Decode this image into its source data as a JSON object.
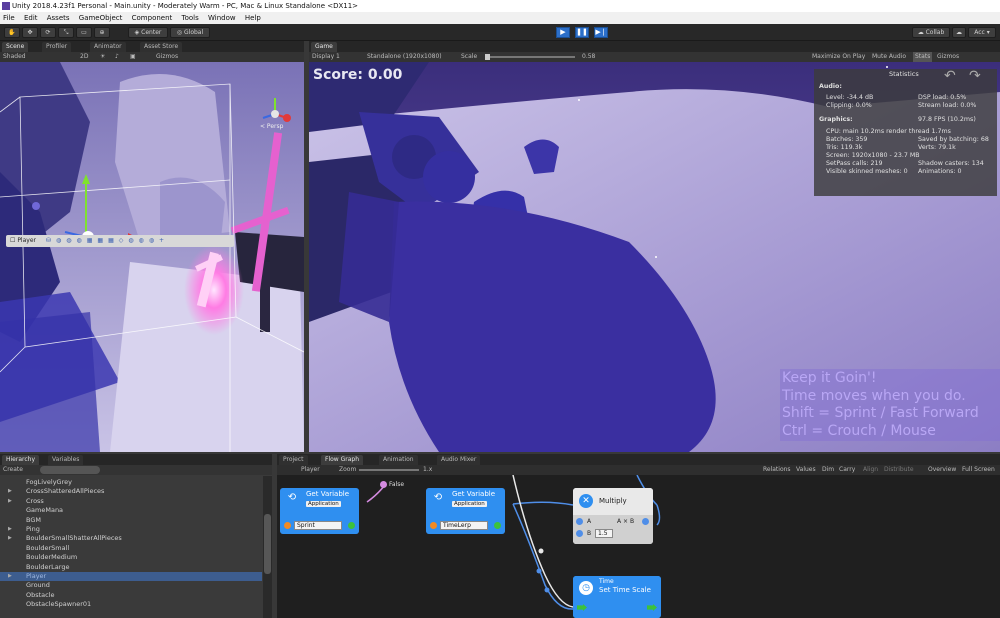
{
  "titlebar": {
    "title": "Unity 2018.4.23f1 Personal - Main.unity - Moderately Warm - PC, Mac & Linux Standalone <DX11>"
  },
  "menu": {
    "items": [
      "File",
      "Edit",
      "Assets",
      "GameObject",
      "Component",
      "Tools",
      "Window",
      "Help"
    ]
  },
  "toolbar": {
    "center_label": "Center",
    "global_label": "Global",
    "play_icon": "play-icon",
    "pause_icon": "pause-icon",
    "step_icon": "step-icon"
  },
  "scene": {
    "tabs": [
      "Scene",
      "Profiler",
      "Animator",
      "Asset Store"
    ],
    "shading_mode": "Shaded",
    "mode_2d": "2D",
    "gizmos_label": "Gizmos",
    "persp_label": "< Persp",
    "selection_label": "Player"
  },
  "game": {
    "tab": "Game",
    "display": "Display 1",
    "resolution": "Standalone (1920x1080)",
    "scale_label": "Scale",
    "scale_value": "0.58",
    "options": [
      "Maximize On Play",
      "Mute Audio",
      "Stats",
      "Gizmos"
    ],
    "score_text": "Score: 0.00",
    "stats": {
      "title": "Statistics",
      "audio_header": "Audio:",
      "level": "Level: -34.4 dB",
      "clipping": "Clipping: 0.0%",
      "dsp_load": "DSP load: 0.5%",
      "stream_load": "Stream load: 0.0%",
      "graphics_header": "Graphics:",
      "fps": "97.8 FPS (10.2ms)",
      "cpu": "CPU: main 10.2ms  render thread 1.7ms",
      "batches": "Batches: 359",
      "saved_batching": "Saved by batching: 68",
      "tris": "Tris: 119.3k",
      "verts": "Verts: 79.1k",
      "screen": "Screen: 1920x1080 - 23.7 MB",
      "setpass": "SetPass calls: 219",
      "shadow_casters": "Shadow casters: 134",
      "skinned": "Visible skinned meshes: 0",
      "animations": "Animations: 0"
    },
    "hint_lines": [
      "Keep it Goin'!",
      "Time moves when you do.",
      "Shift = Sprint / Fast Forward",
      "Ctrl = Crouch / Mouse"
    ]
  },
  "hierarchy": {
    "tabs": [
      "Hierarchy",
      "Variables"
    ],
    "create_label": "Create",
    "items": [
      {
        "name": "FogLivelyGrey",
        "arrow": ""
      },
      {
        "name": "CrossShatteredAllPieces",
        "arrow": "▶"
      },
      {
        "name": "Cross",
        "arrow": "▶"
      },
      {
        "name": "GameMana",
        "arrow": ""
      },
      {
        "name": "BGM",
        "arrow": ""
      },
      {
        "name": "Ping",
        "arrow": "▶"
      },
      {
        "name": "BoulderSmallShatterAllPieces",
        "arrow": "▶"
      },
      {
        "name": "BoulderSmall",
        "arrow": ""
      },
      {
        "name": "BoulderMedium",
        "arrow": ""
      },
      {
        "name": "BoulderLarge",
        "arrow": ""
      },
      {
        "name": "Player",
        "arrow": "▶"
      },
      {
        "name": "Ground",
        "arrow": ""
      },
      {
        "name": "Obstacle",
        "arrow": ""
      },
      {
        "name": "ObstacleSpawner01",
        "arrow": ""
      }
    ]
  },
  "flow": {
    "tabs": [
      "Project",
      "Flow Graph",
      "Animation",
      "Audio Mixer"
    ],
    "breadcrumb": "Player",
    "zoom_label": "Zoom",
    "zoom_value": "1.x",
    "right_options": [
      "Relations",
      "Values",
      "Dim",
      "Carry",
      "Align",
      "Distribute",
      "Overview",
      "Full Screen"
    ],
    "node_get_sprint": {
      "title": "Get Variable",
      "kind": "Application",
      "value": "Sprint"
    },
    "node_get_timelerp": {
      "title": "Get Variable",
      "kind": "Application",
      "value": "TimeLerp"
    },
    "node_multiply": {
      "title": "Multiply",
      "port_a": "A",
      "port_b": "B",
      "b_value": "1.5",
      "result": "A × B"
    },
    "node_time": {
      "category": "Time",
      "title": "Set Time Scale"
    },
    "false_label": "False"
  }
}
